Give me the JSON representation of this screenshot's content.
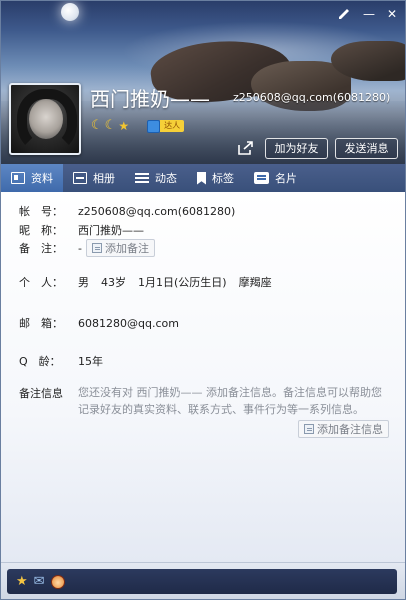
{
  "window": {
    "controls": {
      "skin_icon": "pencil-icon",
      "minimize_glyph": "—",
      "close_glyph": "✕"
    }
  },
  "header": {
    "nickname": "西门推奶——",
    "account_display": "z250608@qq.com(6081280)",
    "level_badges": [
      "☾",
      "☾",
      "★"
    ],
    "vip_label": "达人",
    "share_icon": "share-icon",
    "add_friend_label": "加为好友",
    "send_message_label": "发送消息"
  },
  "tabs": [
    {
      "label": "资料",
      "icon": "profile-card-icon",
      "active": true
    },
    {
      "label": "相册",
      "icon": "photo-album-icon",
      "active": false
    },
    {
      "label": "动态",
      "icon": "feed-list-icon",
      "active": false
    },
    {
      "label": "标签",
      "icon": "bookmark-tag-icon",
      "active": false
    },
    {
      "label": "名片",
      "icon": "namecard-icon",
      "active": false
    }
  ],
  "profile": {
    "account": {
      "label": "帐　号：",
      "value": "z250608@qq.com(6081280)"
    },
    "nickname": {
      "label": "昵　称：",
      "value": "西门推奶——"
    },
    "remark": {
      "label": "备　注：",
      "value": "-",
      "button": "添加备注"
    },
    "personal": {
      "label": "个　人：",
      "gender": "男",
      "age": "43岁",
      "birthday": "1月1日(公历生日)",
      "zodiac": "摩羯座"
    },
    "email": {
      "label": "邮　箱：",
      "value": "6081280@qq.com"
    },
    "qq_age": {
      "label": "Q　龄：",
      "value": "15年"
    },
    "remark_info": {
      "label": "备注信息",
      "note": "您还没有对 西门推奶—— 添加备注信息。备注信息可以帮助您记录好友的真实资料、联系方式、事件行为等一系列信息。",
      "button": "添加备注信息"
    }
  },
  "bottom": {
    "icons": [
      "star-icon",
      "mail-icon",
      "game-character-icon"
    ],
    "star_glyph": "★",
    "mail_glyph": "✉"
  },
  "colors": {
    "tab_bar": "#39507a",
    "tab_active": "#3f6aab",
    "bottom_bar": "#1f2a48",
    "note_text": "#8a8f98"
  }
}
